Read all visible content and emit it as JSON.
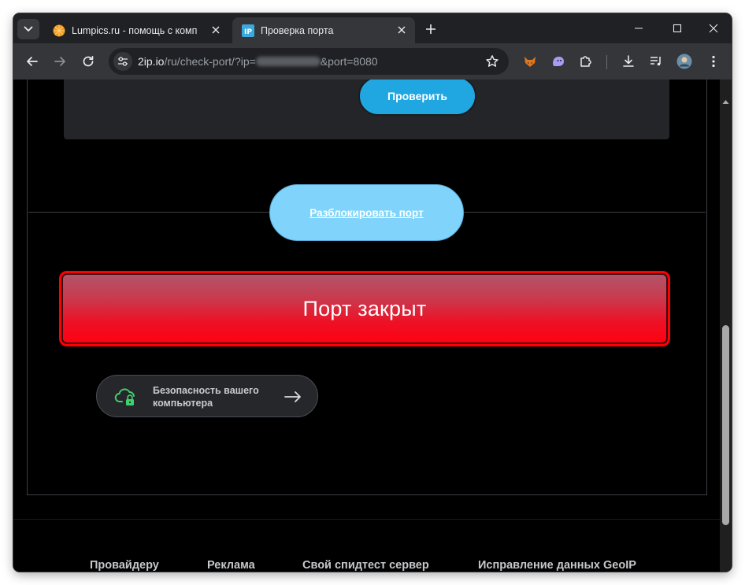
{
  "browser": {
    "tabs": [
      {
        "title": "Lumpics.ru - помощь с компьютером",
        "active": false
      },
      {
        "title": "Проверка порта",
        "active": true
      }
    ],
    "address": {
      "host": "2ip.io",
      "path_before": "/ru/check-port/?ip=",
      "path_after": "&port=8080"
    }
  },
  "page": {
    "check_button": "Проверить",
    "unblock_link": "Разблокировать порт",
    "status_text": "Порт закрыт",
    "security_link": "Безопасность вашего компьютера",
    "footer_links": [
      "Провайдеру",
      "Реклама",
      "Свой спидтест сервер",
      "Исправление данных GeoIP"
    ]
  },
  "colors": {
    "accent_blue": "#20a7e2",
    "light_blue": "#80d4fb",
    "status_red": "#ff0011",
    "security_green": "#3fd06b"
  }
}
